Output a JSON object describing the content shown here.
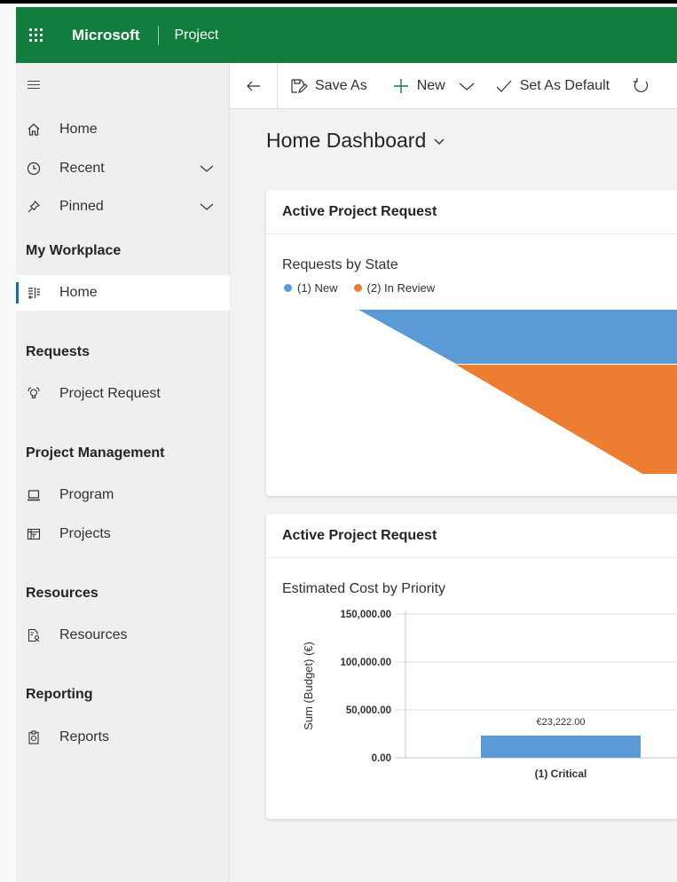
{
  "topbar": {
    "brand": "Microsoft",
    "product": "Project"
  },
  "sidebar": {
    "top_items": [
      {
        "label": "Home",
        "icon": "home-icon"
      },
      {
        "label": "Recent",
        "icon": "clock-icon"
      },
      {
        "label": "Pinned",
        "icon": "pin-icon"
      }
    ],
    "sections": [
      {
        "title": "My Workplace",
        "items": [
          {
            "label": "Home",
            "icon": "dashboard-icon",
            "active": true
          }
        ]
      },
      {
        "title": "Requests",
        "items": [
          {
            "label": "Project Request",
            "icon": "lightbulb-icon"
          }
        ]
      },
      {
        "title": "Project Management",
        "items": [
          {
            "label": "Program",
            "icon": "laptop-icon"
          },
          {
            "label": "Projects",
            "icon": "projects-icon"
          }
        ]
      },
      {
        "title": "Resources",
        "items": [
          {
            "label": "Resources",
            "icon": "resource-icon"
          }
        ]
      },
      {
        "title": "Reporting",
        "items": [
          {
            "label": "Reports",
            "icon": "report-icon"
          }
        ]
      }
    ]
  },
  "commandbar": {
    "save_as": "Save As",
    "new": "New",
    "set_default": "Set As Default"
  },
  "page": {
    "title": "Home Dashboard"
  },
  "cards": [
    {
      "header": "Active Project Request",
      "chart_title": "Requests by State"
    },
    {
      "header": "Active Project Request",
      "chart_title": "Estimated Cost by Priority"
    }
  ],
  "colors": {
    "brand_green": "#117d3c",
    "series_blue": "#5b9bd5",
    "series_orange": "#ed7d31"
  },
  "chart_data": [
    {
      "type": "funnel",
      "title": "Requests by State",
      "series": [
        {
          "name": "(1) New",
          "color": "#5b9bd5"
        },
        {
          "name": "(2) In Review",
          "color": "#ed7d31"
        }
      ],
      "legend": "top-left"
    },
    {
      "type": "bar",
      "title": "Estimated Cost by Priority",
      "ylabel": "Sum (Budget) (€)",
      "categories": [
        "(1) Critical"
      ],
      "values": [
        23222
      ],
      "data_labels": [
        "€23,222.00"
      ],
      "yticks": [
        "150,000.00",
        "100,000.00",
        "50,000.00",
        "0.00"
      ],
      "ylim": [
        0,
        150000
      ],
      "grid": true
    }
  ]
}
